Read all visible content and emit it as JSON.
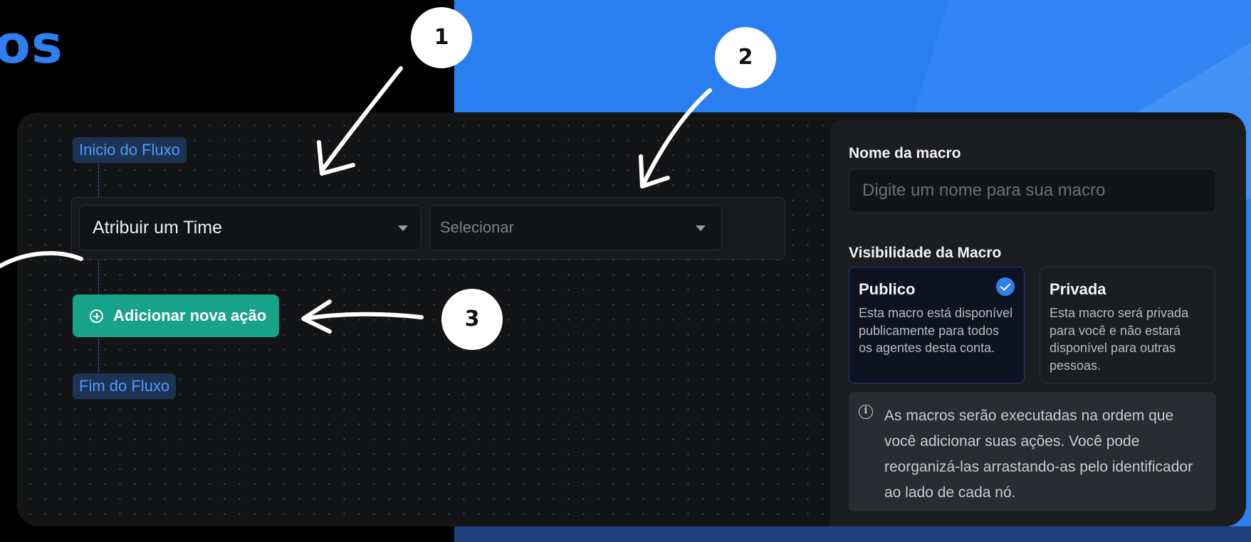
{
  "heading": "os",
  "flow": {
    "start_label": "Inicio do Fluxo",
    "end_label": "Fim do Fluxo",
    "action_select_value": "Atribuir um Time",
    "target_select_placeholder": "Selecionar",
    "add_action_label": "Adicionar nova ação"
  },
  "sidebar": {
    "name_label": "Nome da macro",
    "name_placeholder": "Digite um nome para sua macro",
    "visibility_label": "Visibilidade da Macro",
    "options": [
      {
        "title": "Publico",
        "description": "Esta macro está disponível publicamente para todos os agentes desta conta.",
        "selected": true
      },
      {
        "title": "Privada",
        "description": "Esta macro será privada para você e não estará disponível para outras pessoas.",
        "selected": false
      }
    ],
    "info_text": "As macros serão executadas na ordem que você adicionar suas ações. Você pode reorganizá-las arrastando-as pelo identificador ao lado de cada nó."
  },
  "annotations": [
    "1",
    "2",
    "3"
  ],
  "colors": {
    "accent_blue": "#2f7ff0",
    "add_button_green": "#16a389",
    "panel_bg": "#131416"
  },
  "icons": {
    "add": "plus-circle-icon",
    "check": "check-circle-icon",
    "info": "info-icon",
    "dropdown": "caret-down-icon"
  }
}
